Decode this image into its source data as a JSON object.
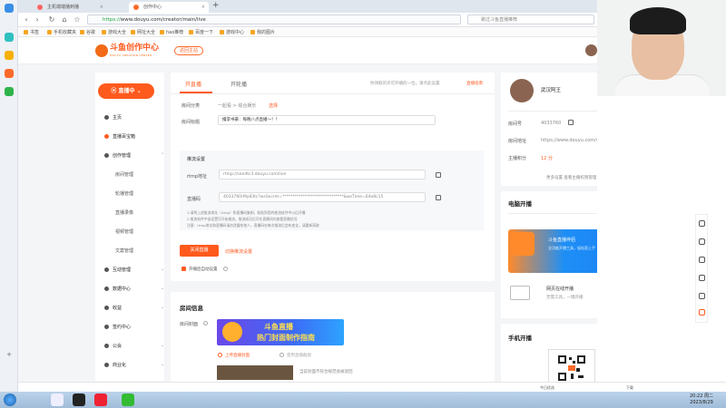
{
  "browser": {
    "tabs": [
      {
        "label": "主机端端播到播"
      },
      {
        "label": "创作中心"
      }
    ],
    "url_prefix": "https://",
    "url_rest": "www.douyu.com/creator/main/live",
    "search_placeholder": "跳过斗鱼直播推荐"
  },
  "bookmarks": [
    "书签",
    "手机收藏夹",
    "谷歌",
    "游戏大全",
    "网址大全",
    "hao推荐",
    "百度一下",
    "游戏中心",
    "我的图片"
  ],
  "site": {
    "logo_main": "斗鱼创作中心",
    "logo_sub": "DOUYU CREATION CENTER",
    "back_link": "返回主站"
  },
  "sidebar": {
    "live_button": "直播中",
    "items": [
      {
        "label": "主页",
        "type": "main",
        "icon": "home-icon"
      },
      {
        "label": "直播百宝箱",
        "type": "main",
        "icon": "toolbox-icon"
      },
      {
        "label": "创作管理",
        "type": "main",
        "icon": "edit-icon",
        "chevron": "⌃"
      },
      {
        "label": "房间管理",
        "type": "sub"
      },
      {
        "label": "轮播管理",
        "type": "sub"
      },
      {
        "label": "直播录像",
        "type": "sub"
      },
      {
        "label": "视频管理",
        "type": "sub"
      },
      {
        "label": "文案管理",
        "type": "sub"
      },
      {
        "label": "互动管理",
        "type": "main",
        "icon": "chat-icon",
        "chevron": "⌄"
      },
      {
        "label": "数据中心",
        "type": "main",
        "icon": "chart-icon",
        "chevron": "⌄"
      },
      {
        "label": "收益",
        "type": "main",
        "icon": "wallet-icon",
        "chevron": "⌄"
      },
      {
        "label": "签约中心",
        "type": "main",
        "icon": "sign-icon"
      },
      {
        "label": "公会",
        "type": "main",
        "icon": "guild-icon",
        "chevron": "⌄"
      },
      {
        "label": "商业化",
        "type": "main",
        "icon": "shop-icon",
        "chevron": "⌄"
      }
    ]
  },
  "main": {
    "tabs": [
      "开直播",
      "开轮播"
    ],
    "notice": "你领取的许可开播的一位，请点此设置",
    "guide_link": "直播指南",
    "room_category_label": "房间分类",
    "room_category_value": "一起看 > 综合娱乐",
    "room_category_action": "选择",
    "room_title_label": "房间标题",
    "room_title_value": "撸李书豪：每晚八点直播～！！",
    "push_title": "推流设置",
    "rtmp_label": "rtmp地址",
    "rtmp_value": "rtmp://sendtc3.douyu.com/live",
    "stream_label": "直播码",
    "stream_value": "4033760rMy83tc?wsSecret=******************************&wsTime=64e8c15",
    "tip1": "1.请将上述推流地址（rtmp）和直播码复制，粘贴到您的推流软件中以后开播",
    "tip2": "2.推流软件中该设置可开始推流，推流成功后可在直播间内查看直播状况",
    "tip3": "注意：rtmp地址和直播码请勿泄露给他人，直播码在每次推流后会有变化，请重新获取",
    "close_button": "关闭直播",
    "reset_link": "切换推流设置",
    "auto_checkbox": "开播后自动设置"
  },
  "room_info": {
    "title": "房间信息",
    "cover_label": "房间封面",
    "cover_line1": "斗鱼直播",
    "cover_line2": "热门封面制作指南",
    "radio_selected": "上传直播封面",
    "radio_other": "使用直播截图",
    "thumb_caption": "当前封面不符合规范会被驳回"
  },
  "profile": {
    "name": "武汉阿王",
    "room_label": "房间号",
    "room_value": "4033760",
    "addr_label": "房间地址",
    "addr_value": "https://www.douyu.com/4033760",
    "points_label": "主播积分",
    "points_value": "12 分",
    "links": "更多设置   查看主播权限管理 ›"
  },
  "pc_live": {
    "title": "电脑开播",
    "banner_title": "斗鱼直播伴侣",
    "banner_text": "全功能开播工具，轻松直上手",
    "web_title": "网页在线开播",
    "web_sub": "无需工具，一键开播",
    "web_button": "开始直播"
  },
  "mobile_live": {
    "title": "手机开播"
  },
  "statusbar": {
    "left": "今日优选",
    "right": "下载"
  },
  "taskbar": {
    "time": "20:22 周二",
    "date": "2023/8/29"
  },
  "colors": {
    "accent": "#ff5d23",
    "link": "#2b7ce9"
  }
}
